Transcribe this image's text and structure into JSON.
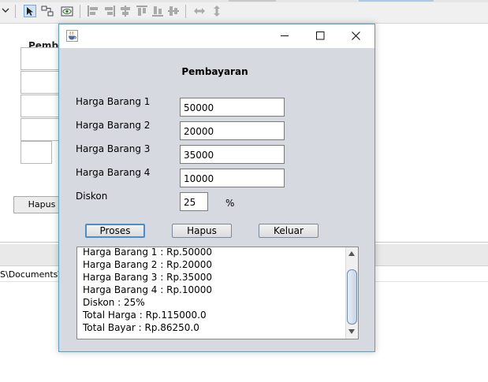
{
  "ide": {
    "background_title": "Pembayaran",
    "hapus_label": "Hapus",
    "path_text": "S\\Documents\\N"
  },
  "dialog": {
    "title": "",
    "icon": "java-cup-icon",
    "form_title": "Pembayaran",
    "labels": [
      "Harga Barang 1",
      "Harga Barang 2",
      "Harga Barang 3",
      "Harga Barang 4",
      "Diskon"
    ],
    "values": [
      "50000",
      "20000",
      "35000",
      "10000",
      "25"
    ],
    "percent_sign": "%",
    "buttons": {
      "proses": "Proses",
      "hapus": "Hapus",
      "keluar": "Keluar"
    },
    "output_lines": [
      "Harga Barang 1 : Rp.50000",
      "Harga Barang 2 : Rp.20000",
      "Harga Barang 3 : Rp.35000",
      "Harga Barang 4 : Rp.10000",
      "Diskon : 25%",
      "Total Harga : Rp.115000.0",
      "Total Bayar : Rp.86250.0"
    ]
  },
  "colors": {
    "window_border": "#53a3c6",
    "window_bg": "#d6d9df",
    "focus_border": "#4c8cc9"
  }
}
